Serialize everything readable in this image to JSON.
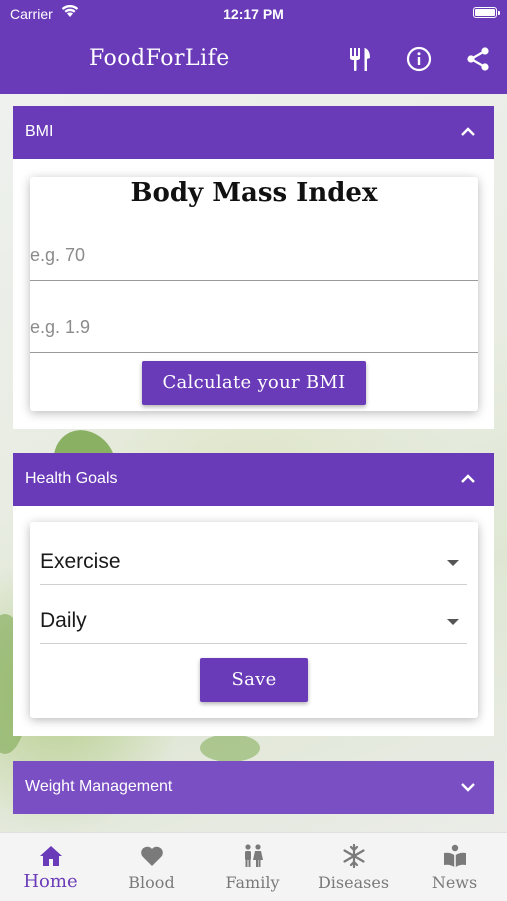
{
  "status": {
    "carrier": "Carrier",
    "time": "12:17 PM"
  },
  "appbar": {
    "title": "FoodForLife",
    "icons": [
      "restaurant-icon",
      "info-icon",
      "share-icon"
    ]
  },
  "bmi": {
    "header": "BMI",
    "card_title": "Body Mass Index",
    "weight_placeholder": "e.g. 70",
    "height_placeholder": "e.g. 1.9",
    "calculate_label": "Calculate your BMI"
  },
  "health_goals": {
    "header": "Health Goals",
    "goal_value": "Exercise",
    "frequency_value": "Daily",
    "save_label": "Save"
  },
  "weight_management": {
    "header": "Weight Management"
  },
  "nav": {
    "items": [
      {
        "label": "Home",
        "icon": "home-icon",
        "active": true
      },
      {
        "label": "Blood",
        "icon": "heart-icon",
        "active": false
      },
      {
        "label": "Family",
        "icon": "family-icon",
        "active": false
      },
      {
        "label": "Diseases",
        "icon": "snowflake-icon",
        "active": false
      },
      {
        "label": "News",
        "icon": "book-icon",
        "active": false
      }
    ]
  },
  "colors": {
    "primary": "#6a3bb8",
    "nav_bg": "#f4f4f4",
    "inactive": "#7a7a7a"
  }
}
